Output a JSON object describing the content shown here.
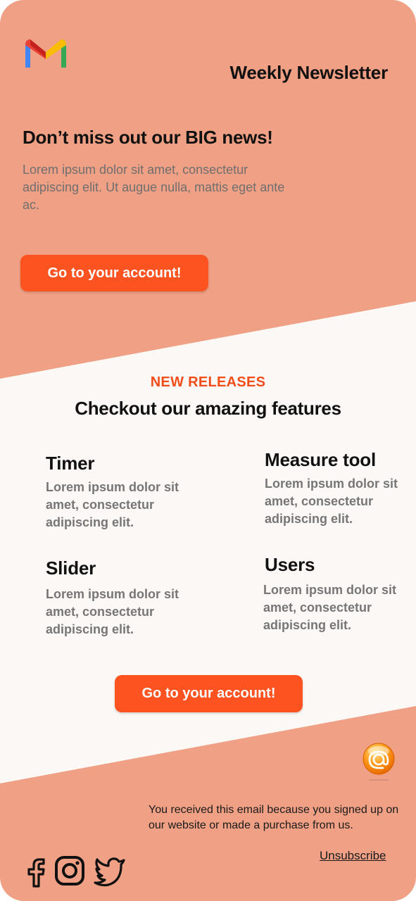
{
  "theme": {
    "salmon": "#f0a084",
    "background": "#fcf8f6",
    "accent": "#fc5320",
    "kicker": "#f04d1a"
  },
  "header": {
    "logo_icon": "gmail-icon",
    "title": "Weekly Newsletter"
  },
  "hero": {
    "title": "Don’t miss out our BIG news!",
    "text": "Lorem ipsum dolor sit amet, consectetur adipiscing elit. Ut augue nulla, mattis eget ante ac.",
    "cta_label": "Go to your account!"
  },
  "features_section": {
    "kicker": "NEW RELEASES",
    "title": "Checkout our amazing features",
    "items": [
      {
        "title": "Timer",
        "text": "Lorem ipsum dolor sit amet, consectetur adipiscing elit."
      },
      {
        "title": "Measure tool",
        "text": "Lorem ipsum dolor sit amet, consectetur adipiscing elit."
      },
      {
        "title": "Slider",
        "text": "Lorem ipsum dolor sit amet, consectetur adipiscing elit."
      },
      {
        "title": "Users",
        "text": "Lorem ipsum dolor sit amet, consectetur adipiscing elit."
      }
    ],
    "cta_label": "Go to your account!"
  },
  "footer": {
    "badge_icon": "email-at-icon",
    "note": "You received this email because you signed up on our website or made a purchase from us.",
    "unsubscribe_label": "Unsubscribe",
    "social_icons": [
      "facebook-icon",
      "instagram-icon",
      "twitter-icon"
    ]
  }
}
